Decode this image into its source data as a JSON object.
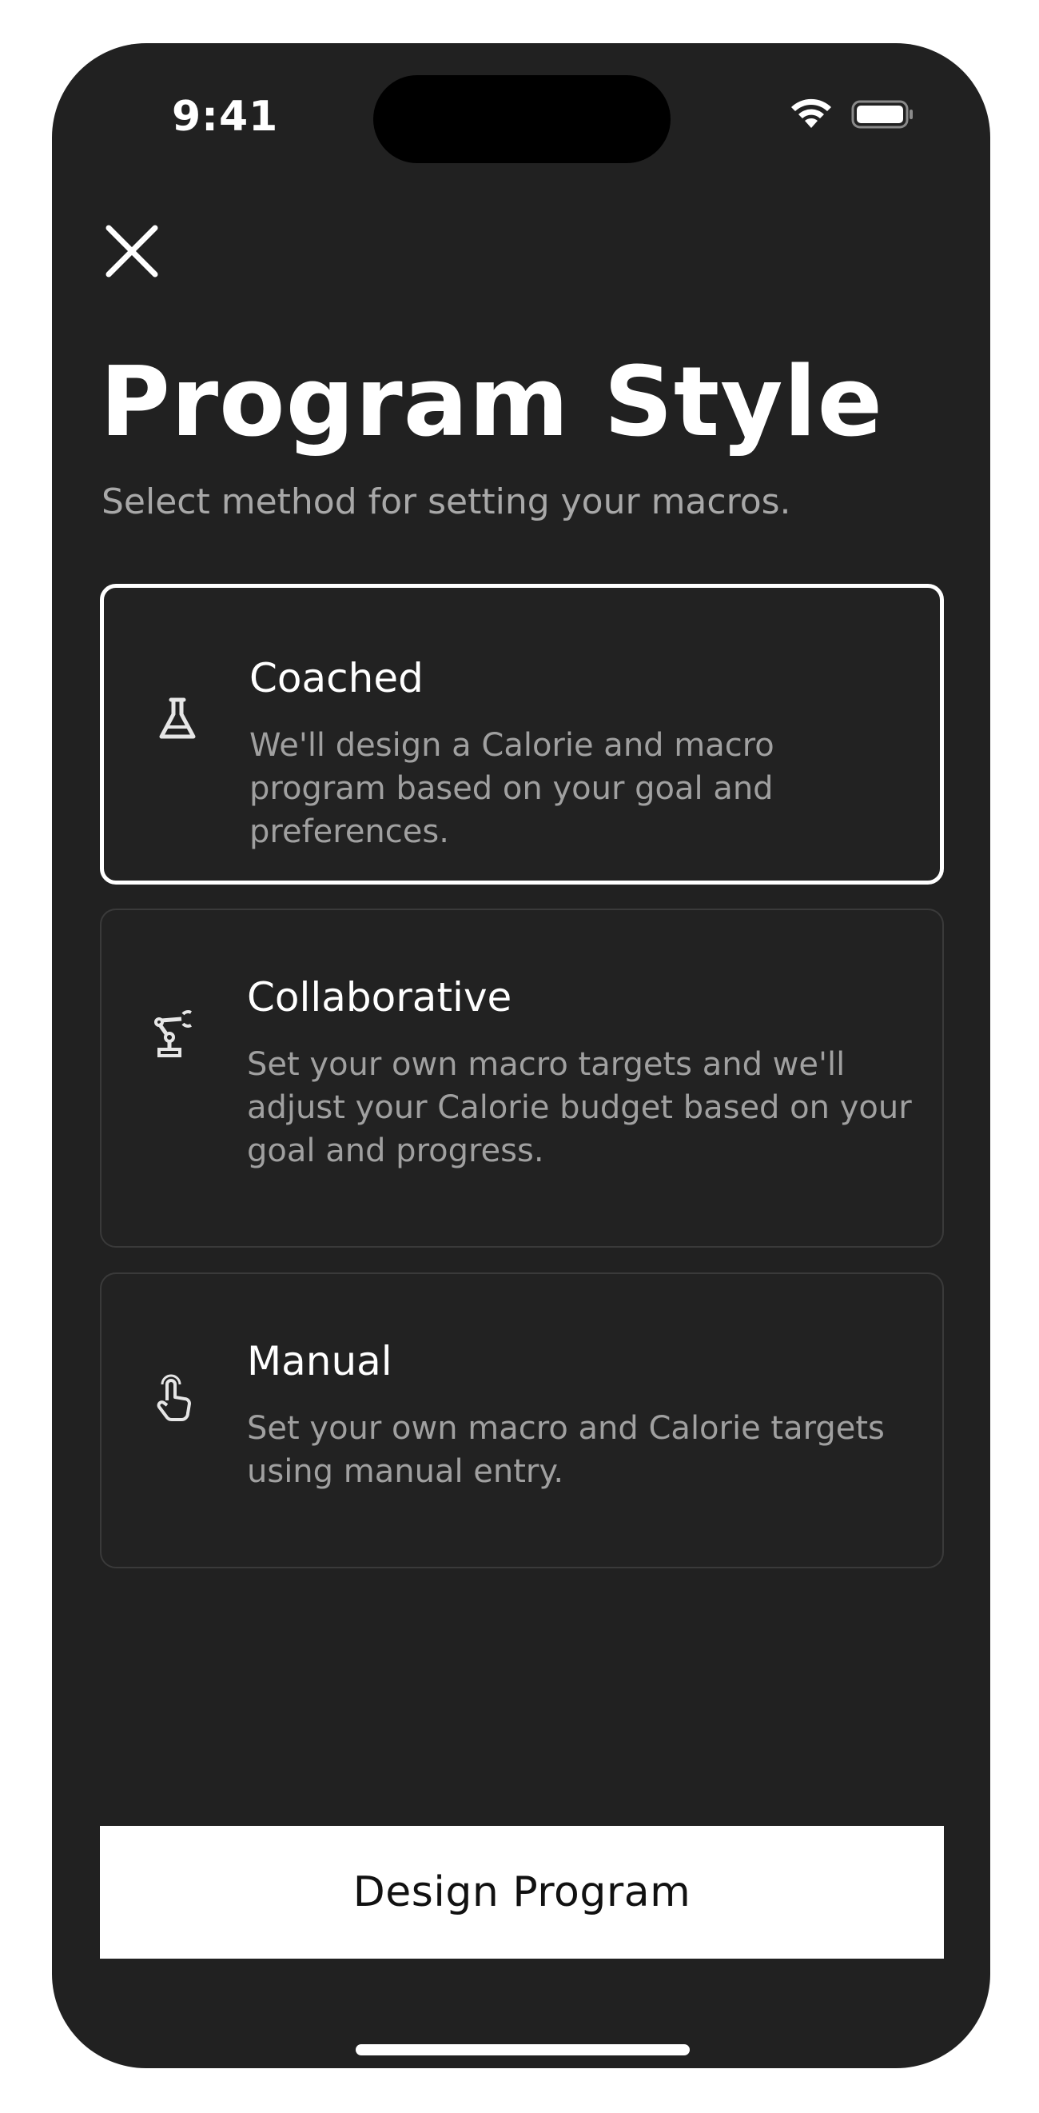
{
  "status_bar": {
    "time": "9:41"
  },
  "header": {
    "close_icon": "close-icon",
    "title": "Program Style",
    "subtitle": "Select method for setting your macros."
  },
  "options": [
    {
      "title": "Coached",
      "description": "We'll design a Calorie and macro program based on your goal and preferences.",
      "icon": "flask-icon",
      "selected": true
    },
    {
      "title": "Collaborative",
      "description": "Set your own macro targets and we'll adjust your Calorie budget based on your goal and progress.",
      "icon": "robot-arm-icon",
      "selected": false
    },
    {
      "title": "Manual",
      "description": "Set your own macro and Calorie targets using manual entry.",
      "icon": "hand-pointer-icon",
      "selected": false
    }
  ],
  "footer": {
    "primary_button": "Design Program"
  },
  "colors": {
    "background": "#212121",
    "card_border": "#3a3a3a",
    "selected_border": "#ffffff",
    "secondary_text": "#a0a0a0"
  }
}
